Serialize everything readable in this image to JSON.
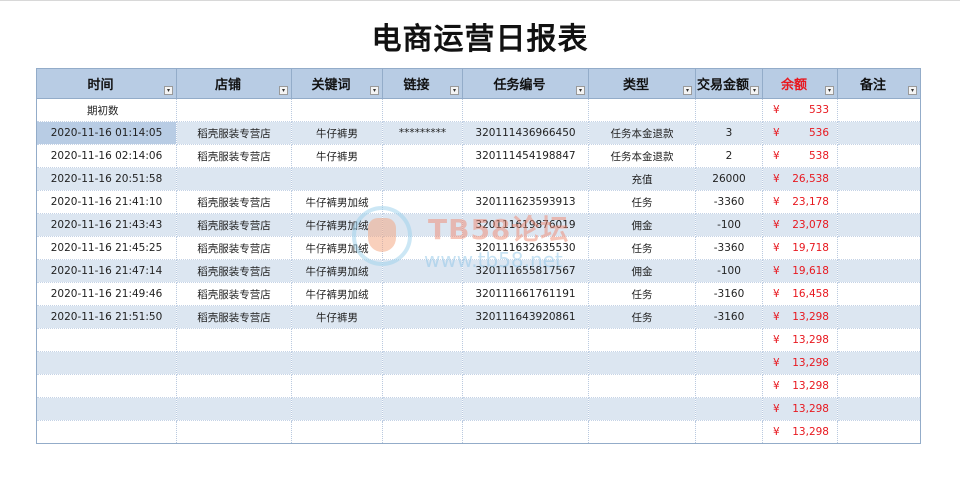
{
  "title": "电商运营日报表",
  "columns": [
    {
      "label": "时间",
      "red": false
    },
    {
      "label": "店铺",
      "red": false
    },
    {
      "label": "关键词",
      "red": false
    },
    {
      "label": "链接",
      "red": false
    },
    {
      "label": "任务编号",
      "red": false
    },
    {
      "label": "类型",
      "red": false
    },
    {
      "label": "交易金额",
      "red": false
    },
    {
      "label": "余额",
      "red": true
    },
    {
      "label": "备注",
      "red": false
    }
  ],
  "filter_glyph": "▾",
  "currency_symbol": "¥",
  "selected_cell": "2020-11-16 01:14:05",
  "rows": [
    {
      "time": "期初数",
      "shop": "",
      "keyword": "",
      "link": "",
      "task": "",
      "type": "",
      "amount": "",
      "balance": "533",
      "note": ""
    },
    {
      "time": "2020-11-16 01:14:05",
      "shop": "稻壳服装专营店",
      "keyword": "牛仔裤男",
      "link": "*********",
      "task": "320111436966450",
      "type": "任务本金退款",
      "amount": "3",
      "balance": "536",
      "note": ""
    },
    {
      "time": "2020-11-16 02:14:06",
      "shop": "稻壳服装专营店",
      "keyword": "牛仔裤男",
      "link": "",
      "task": "320111454198847",
      "type": "任务本金退款",
      "amount": "2",
      "balance": "538",
      "note": ""
    },
    {
      "time": "2020-11-16 20:51:58",
      "shop": "",
      "keyword": "",
      "link": "",
      "task": "",
      "type": "充值",
      "amount": "26000",
      "balance": "26,538",
      "note": ""
    },
    {
      "time": "2020-11-16 21:41:10",
      "shop": "稻壳服装专营店",
      "keyword": "牛仔裤男加绒",
      "link": "",
      "task": "320111623593913",
      "type": "任务",
      "amount": "-3360",
      "balance": "23,178",
      "note": ""
    },
    {
      "time": "2020-11-16 21:43:43",
      "shop": "稻壳服装专营店",
      "keyword": "牛仔裤男加绒",
      "link": "",
      "task": "320111619876019",
      "type": "佣金",
      "amount": "-100",
      "balance": "23,078",
      "note": ""
    },
    {
      "time": "2020-11-16 21:45:25",
      "shop": "稻壳服装专营店",
      "keyword": "牛仔裤男加绒",
      "link": "",
      "task": "320111632635530",
      "type": "任务",
      "amount": "-3360",
      "balance": "19,718",
      "note": ""
    },
    {
      "time": "2020-11-16 21:47:14",
      "shop": "稻壳服装专营店",
      "keyword": "牛仔裤男加绒",
      "link": "",
      "task": "320111655817567",
      "type": "佣金",
      "amount": "-100",
      "balance": "19,618",
      "note": ""
    },
    {
      "time": "2020-11-16 21:49:46",
      "shop": "稻壳服装专营店",
      "keyword": "牛仔裤男加绒",
      "link": "",
      "task": "320111661761191",
      "type": "任务",
      "amount": "-3160",
      "balance": "16,458",
      "note": ""
    },
    {
      "time": "2020-11-16 21:51:50",
      "shop": "稻壳服装专营店",
      "keyword": "牛仔裤男",
      "link": "",
      "task": "320111643920861",
      "type": "任务",
      "amount": "-3160",
      "balance": "13,298",
      "note": ""
    },
    {
      "time": "",
      "shop": "",
      "keyword": "",
      "link": "",
      "task": "",
      "type": "",
      "amount": "",
      "balance": "13,298",
      "note": ""
    },
    {
      "time": "",
      "shop": "",
      "keyword": "",
      "link": "",
      "task": "",
      "type": "",
      "amount": "",
      "balance": "13,298",
      "note": ""
    },
    {
      "time": "",
      "shop": "",
      "keyword": "",
      "link": "",
      "task": "",
      "type": "",
      "amount": "",
      "balance": "13,298",
      "note": ""
    },
    {
      "time": "",
      "shop": "",
      "keyword": "",
      "link": "",
      "task": "",
      "type": "",
      "amount": "",
      "balance": "13,298",
      "note": ""
    },
    {
      "time": "",
      "shop": "",
      "keyword": "",
      "link": "",
      "task": "",
      "type": "",
      "amount": "",
      "balance": "13,298",
      "note": ""
    }
  ],
  "watermark": {
    "brand": "TB58论坛",
    "site": "www.tb58.net"
  },
  "colors": {
    "header_bg": "#b8cce4",
    "alt_row_bg": "#dce6f1",
    "balance_red": "#e8181f"
  }
}
